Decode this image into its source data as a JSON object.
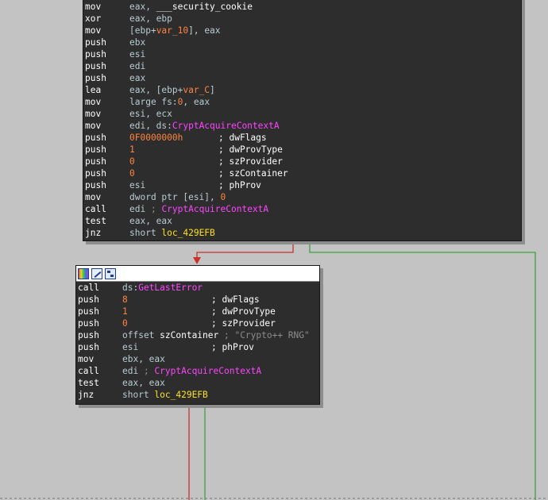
{
  "nodes": [
    {
      "lines": [
        {
          "mn": "mov",
          "ops": [
            {
              "t": "eax, ",
              "c": "reg"
            },
            {
              "t": "___security_cookie",
              "c": "sym"
            }
          ]
        },
        {
          "mn": "xor",
          "ops": [
            {
              "t": "eax, ebp",
              "c": "reg"
            }
          ]
        },
        {
          "mn": "mov",
          "ops": [
            {
              "t": "[ebp+",
              "c": "reg"
            },
            {
              "t": "var_10",
              "c": "var"
            },
            {
              "t": "], eax",
              "c": "reg"
            }
          ]
        },
        {
          "mn": "push",
          "ops": [
            {
              "t": "ebx",
              "c": "reg"
            }
          ]
        },
        {
          "mn": "push",
          "ops": [
            {
              "t": "esi",
              "c": "reg"
            }
          ]
        },
        {
          "mn": "push",
          "ops": [
            {
              "t": "edi",
              "c": "reg"
            }
          ]
        },
        {
          "mn": "push",
          "ops": [
            {
              "t": "eax",
              "c": "reg"
            }
          ]
        },
        {
          "mn": "lea",
          "ops": [
            {
              "t": "eax, [ebp+",
              "c": "reg"
            },
            {
              "t": "var_C",
              "c": "var"
            },
            {
              "t": "]",
              "c": "reg"
            }
          ]
        },
        {
          "mn": "mov",
          "ops": [
            {
              "t": "large fs:",
              "c": "reg"
            },
            {
              "t": "0",
              "c": "num"
            },
            {
              "t": ", eax",
              "c": "reg"
            }
          ]
        },
        {
          "mn": "mov",
          "ops": [
            {
              "t": "esi, ecx",
              "c": "reg"
            }
          ]
        },
        {
          "mn": "mov",
          "ops": [
            {
              "t": "edi, ds:",
              "c": "reg"
            },
            {
              "t": "CryptAcquireContextA",
              "c": "imp"
            }
          ]
        },
        {
          "mn": "push",
          "ops": [
            {
              "t": "0F0000000h",
              "c": "num"
            }
          ],
          "cmt": "; dwFlags"
        },
        {
          "mn": "push",
          "ops": [
            {
              "t": "1",
              "c": "num"
            }
          ],
          "cmt": "; dwProvType"
        },
        {
          "mn": "push",
          "ops": [
            {
              "t": "0",
              "c": "num"
            }
          ],
          "cmt": "; szProvider"
        },
        {
          "mn": "push",
          "ops": [
            {
              "t": "0",
              "c": "num"
            }
          ],
          "cmt": "; szContainer"
        },
        {
          "mn": "push",
          "ops": [
            {
              "t": "esi",
              "c": "reg"
            }
          ],
          "cmt": "; phProv"
        },
        {
          "mn": "mov",
          "ops": [
            {
              "t": "dword ptr [esi], ",
              "c": "reg"
            },
            {
              "t": "0",
              "c": "num"
            }
          ]
        },
        {
          "mn": "call",
          "ops": [
            {
              "t": "edi ",
              "c": "reg"
            },
            {
              "t": "; ",
              "c": "dim"
            },
            {
              "t": "CryptAcquireContextA",
              "c": "imp"
            }
          ]
        },
        {
          "mn": "test",
          "ops": [
            {
              "t": "eax, eax",
              "c": "reg"
            }
          ]
        },
        {
          "mn": "jnz",
          "ops": [
            {
              "t": "short ",
              "c": "reg"
            },
            {
              "t": "loc_429EFB",
              "c": "loc"
            }
          ]
        }
      ]
    },
    {
      "lines": [
        {
          "mn": "call",
          "ops": [
            {
              "t": "ds:",
              "c": "reg"
            },
            {
              "t": "GetLastError",
              "c": "imp"
            }
          ]
        },
        {
          "mn": "push",
          "ops": [
            {
              "t": "8",
              "c": "num"
            }
          ],
          "cmt": "; dwFlags"
        },
        {
          "mn": "push",
          "ops": [
            {
              "t": "1",
              "c": "num"
            }
          ],
          "cmt": "; dwProvType"
        },
        {
          "mn": "push",
          "ops": [
            {
              "t": "0",
              "c": "num"
            }
          ],
          "cmt": "; szProvider"
        },
        {
          "mn": "push",
          "ops": [
            {
              "t": "offset ",
              "c": "reg"
            },
            {
              "t": "szContainer",
              "c": "sym"
            },
            {
              "t": " ; \"Crypto++ RNG\"",
              "c": "dim"
            }
          ]
        },
        {
          "mn": "push",
          "ops": [
            {
              "t": "esi",
              "c": "reg"
            }
          ],
          "cmt": "; phProv"
        },
        {
          "mn": "mov",
          "ops": [
            {
              "t": "ebx, eax",
              "c": "reg"
            }
          ]
        },
        {
          "mn": "call",
          "ops": [
            {
              "t": "edi ",
              "c": "reg"
            },
            {
              "t": "; ",
              "c": "dim"
            },
            {
              "t": "CryptAcquireContextA",
              "c": "imp"
            }
          ]
        },
        {
          "mn": "test",
          "ops": [
            {
              "t": "eax, eax",
              "c": "reg"
            }
          ]
        },
        {
          "mn": "jnz",
          "ops": [
            {
              "t": "short ",
              "c": "reg"
            },
            {
              "t": "loc_429EFB",
              "c": "loc"
            }
          ]
        }
      ]
    }
  ],
  "colors": {
    "background": "#c3c3c3",
    "node_bg": "#2d2d2d",
    "edge_false": "#c8302a",
    "edge_true": "#3aa43a"
  }
}
